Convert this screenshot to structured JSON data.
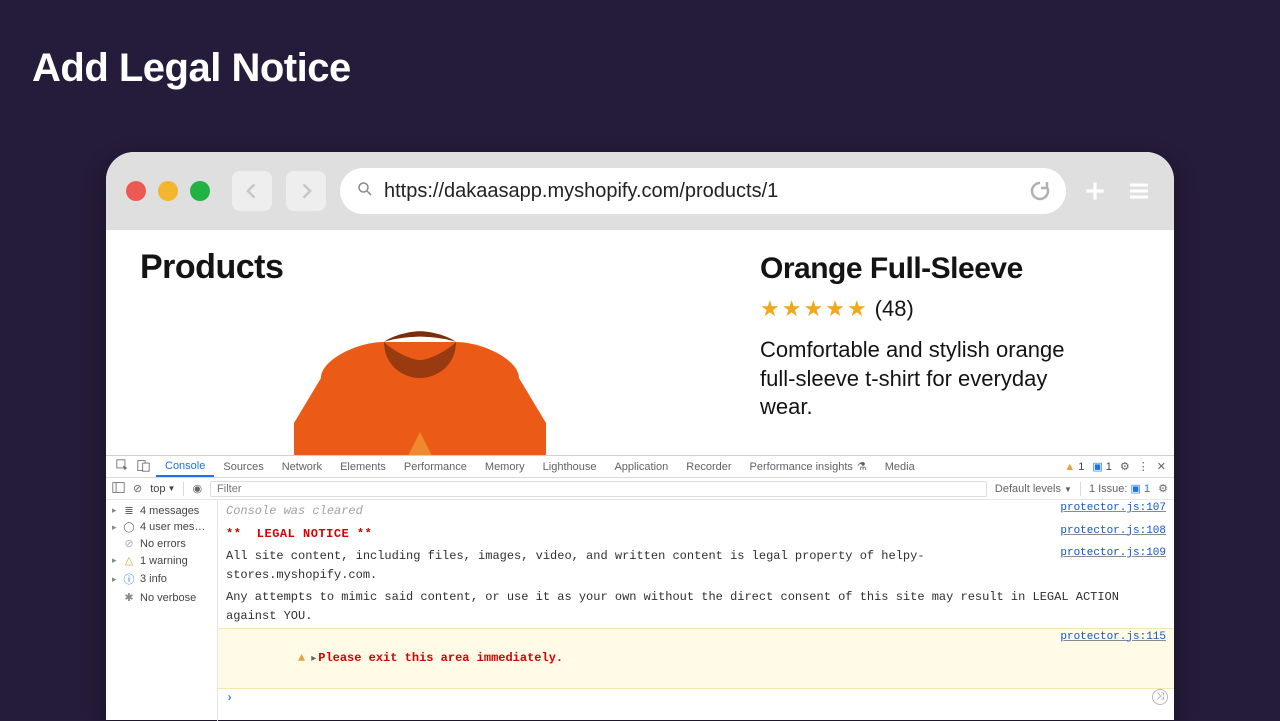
{
  "page": {
    "title": "Add Legal Notice"
  },
  "browser": {
    "url": "https://dakaasapp.myshopify.com/products/1"
  },
  "product_page": {
    "heading": "Products",
    "product": {
      "title": "Orange Full-Sleeve",
      "rating_count": "(48)",
      "description": "Comfortable and stylish orange full-sleeve t-shirt for everyday wear."
    }
  },
  "devtools": {
    "tabs": [
      "Console",
      "Sources",
      "Network",
      "Elements",
      "Performance",
      "Memory",
      "Lighthouse",
      "Application",
      "Recorder",
      "Performance insights",
      "Media"
    ],
    "active_tab": "Console",
    "status": {
      "warnings": "1",
      "info": "1"
    },
    "filter": {
      "context": "top",
      "placeholder": "Filter",
      "levels_label": "Default levels",
      "issues_label": "1 Issue:",
      "issues_count": "1"
    },
    "sidebar": {
      "messages": "4 messages",
      "user_messages": "4 user mes…",
      "errors": "No errors",
      "warnings": "1 warning",
      "info": "3 info",
      "verbose": "No verbose"
    },
    "console": {
      "cleared": "Console was cleared",
      "legal_heading": "**  LEGAL NOTICE **",
      "legal_body_1": "All site content, including files, images, video, and written content is legal property of helpy-stores.myshopify.com.",
      "legal_body_2": "Any attempts to mimic said content, or use it as your own without the direct consent of this site may result in LEGAL ACTION against YOU.",
      "warn": "Please exit this area immediately.",
      "src_107": "protector.js:107",
      "src_108": "protector.js:108",
      "src_109": "protector.js:109",
      "src_115": "protector.js:115"
    }
  }
}
